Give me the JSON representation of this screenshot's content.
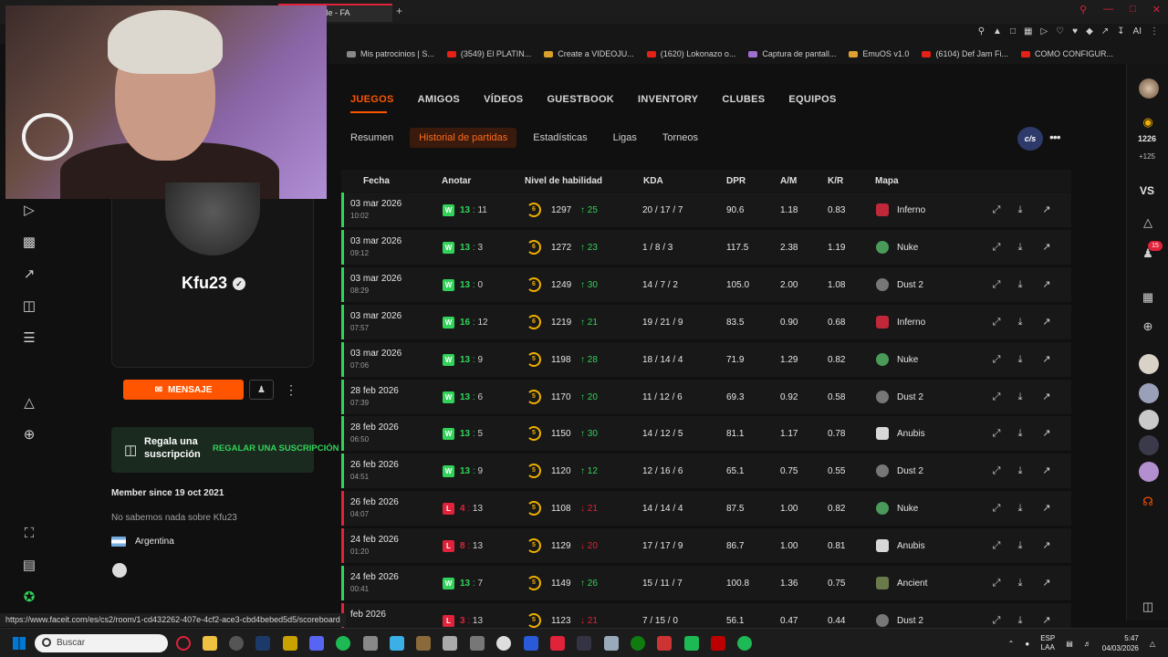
{
  "browser": {
    "active_tab_title": "Player Profile - FA",
    "new_tab_label": "+",
    "bookmarks": [
      "Mis patrocinios | S...",
      "(3549) El PLATIN...",
      "Create a VIDEOJU...",
      "(1620) Lokonazo o...",
      "Captura de pantall...",
      "EmuOS v1.0",
      "(6104) Def Jam Fi...",
      "COMO CONFIGUR..."
    ],
    "toolbar_ai_label": "AI",
    "status_url": "https://www.faceit.com/es/cs2/room/1-cd432262-407e-4cf2-ace3-cbd4bebed5d5/scoreboard"
  },
  "profile": {
    "username": "Kfu23",
    "message_button": "MENSAJE",
    "gift_title": "Regala una suscripción",
    "gift_button": "REGALAR UNA SUSCRIPCIÓN",
    "member_since": "Member since 19 oct 2021",
    "about": "No sabemos nada sobre Kfu23",
    "country": "Argentina"
  },
  "nav": {
    "main_tabs": [
      "JUEGOS",
      "AMIGOS",
      "VÍDEOS",
      "GUESTBOOK",
      "INVENTORY",
      "CLUBES",
      "EQUIPOS"
    ],
    "active_main_tab": "JUEGOS",
    "sub_tabs": [
      "Resumen",
      "Historial de partidas",
      "Estadísticas",
      "Ligas",
      "Torneos"
    ],
    "active_sub_tab": "Historial de partidas",
    "game_badge": "c/s"
  },
  "table": {
    "headers": [
      "Fecha",
      "Anotar",
      "Nivel de habilidad",
      "KDA",
      "DPR",
      "A/M",
      "K/R",
      "Mapa"
    ],
    "rows": [
      {
        "date": "03 mar 2026",
        "time": "10:02",
        "result": "W",
        "score_a": "13",
        "score_b": "11",
        "level": "6",
        "elo": "1297",
        "delta": "25",
        "dir": "up",
        "kda": "20 / 17 / 7",
        "dpr": "90.6",
        "am": "1.18",
        "kr": "0.83",
        "map": "Inferno"
      },
      {
        "date": "03 mar 2026",
        "time": "09:12",
        "result": "W",
        "score_a": "13",
        "score_b": "3",
        "level": "6",
        "elo": "1272",
        "delta": "23",
        "dir": "up",
        "kda": "1 / 8 / 3",
        "dpr": "117.5",
        "am": "2.38",
        "kr": "1.19",
        "map": "Nuke"
      },
      {
        "date": "03 mar 2026",
        "time": "08:29",
        "result": "W",
        "score_a": "13",
        "score_b": "0",
        "level": "6",
        "elo": "1249",
        "delta": "30",
        "dir": "up",
        "kda": "14 / 7 / 2",
        "dpr": "105.0",
        "am": "2.00",
        "kr": "1.08",
        "map": "Dust 2"
      },
      {
        "date": "03 mar 2026",
        "time": "07:57",
        "result": "W",
        "score_a": "16",
        "score_b": "12",
        "level": "6",
        "elo": "1219",
        "delta": "21",
        "dir": "up",
        "kda": "19 / 21 / 9",
        "dpr": "83.5",
        "am": "0.90",
        "kr": "0.68",
        "map": "Inferno"
      },
      {
        "date": "03 mar 2026",
        "time": "07:06",
        "result": "W",
        "score_a": "13",
        "score_b": "9",
        "level": "5",
        "elo": "1198",
        "delta": "28",
        "dir": "up",
        "kda": "18 / 14 / 4",
        "dpr": "71.9",
        "am": "1.29",
        "kr": "0.82",
        "map": "Nuke"
      },
      {
        "date": "28 feb 2026",
        "time": "07:39",
        "result": "W",
        "score_a": "13",
        "score_b": "6",
        "level": "5",
        "elo": "1170",
        "delta": "20",
        "dir": "up",
        "kda": "11 / 12 / 6",
        "dpr": "69.3",
        "am": "0.92",
        "kr": "0.58",
        "map": "Dust 2"
      },
      {
        "date": "28 feb 2026",
        "time": "06:50",
        "result": "W",
        "score_a": "13",
        "score_b": "5",
        "level": "5",
        "elo": "1150",
        "delta": "30",
        "dir": "up",
        "kda": "14 / 12 / 5",
        "dpr": "81.1",
        "am": "1.17",
        "kr": "0.78",
        "map": "Anubis"
      },
      {
        "date": "26 feb 2026",
        "time": "04:51",
        "result": "W",
        "score_a": "13",
        "score_b": "9",
        "level": "5",
        "elo": "1120",
        "delta": "12",
        "dir": "up",
        "kda": "12 / 16 / 6",
        "dpr": "65.1",
        "am": "0.75",
        "kr": "0.55",
        "map": "Dust 2"
      },
      {
        "date": "26 feb 2026",
        "time": "04:07",
        "result": "L",
        "score_a": "4",
        "score_b": "13",
        "level": "5",
        "elo": "1108",
        "delta": "21",
        "dir": "down",
        "kda": "14 / 14 / 4",
        "dpr": "87.5",
        "am": "1.00",
        "kr": "0.82",
        "map": "Nuke"
      },
      {
        "date": "24 feb 2026",
        "time": "01:20",
        "result": "L",
        "score_a": "8",
        "score_b": "13",
        "level": "5",
        "elo": "1129",
        "delta": "20",
        "dir": "down",
        "kda": "17 / 17 / 9",
        "dpr": "86.7",
        "am": "1.00",
        "kr": "0.81",
        "map": "Anubis"
      },
      {
        "date": "24 feb 2026",
        "time": "00:41",
        "result": "W",
        "score_a": "13",
        "score_b": "7",
        "level": "5",
        "elo": "1149",
        "delta": "26",
        "dir": "up",
        "kda": "15 / 11 / 7",
        "dpr": "100.8",
        "am": "1.36",
        "kr": "0.75",
        "map": "Ancient"
      },
      {
        "date": "feb 2026",
        "time": "",
        "result": "L",
        "score_a": "3",
        "score_b": "13",
        "level": "5",
        "elo": "1123",
        "delta": "21",
        "dir": "down",
        "kda": "7 / 15 / 0",
        "dpr": "56.1",
        "am": "0.47",
        "kr": "0.44",
        "map": "Dust 2"
      }
    ]
  },
  "right_sidebar": {
    "coins": "1226",
    "coins_sub": "+125",
    "vs_label": "VS",
    "notif_count": "15"
  },
  "taskbar": {
    "search_placeholder": "Buscar",
    "lang_top": "ESP",
    "lang_bottom": "LAA",
    "time": "5:47",
    "date": "04/03/2026"
  },
  "colors": {
    "accent": "#ff5500",
    "win": "#32d35a",
    "loss": "#e0223a",
    "level": "#f0b000"
  }
}
